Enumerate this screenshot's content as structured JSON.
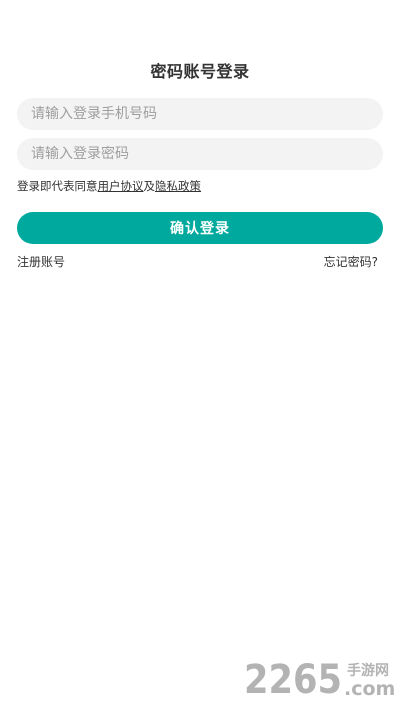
{
  "page": {
    "title": "密码账号登录"
  },
  "form": {
    "phone_placeholder": "请输入登录手机号码",
    "phone_value": "",
    "password_placeholder": "请输入登录密码",
    "password_value": ""
  },
  "agreement": {
    "prefix": "登录即代表同意",
    "user_agreement": "用户协议",
    "conjunction": "及",
    "privacy_policy": "隐私政策"
  },
  "actions": {
    "confirm_label": "确认登录",
    "register_label": "注册账号",
    "forgot_label": "忘记密码?"
  },
  "watermark": {
    "number": "2265",
    "domain": ".com",
    "site_name": "手游网"
  },
  "colors": {
    "accent": "#00a99d",
    "input_background": "#f3f3f3",
    "text": "#333333",
    "placeholder": "#9e9e9e",
    "watermark": "#b3b3b3"
  }
}
